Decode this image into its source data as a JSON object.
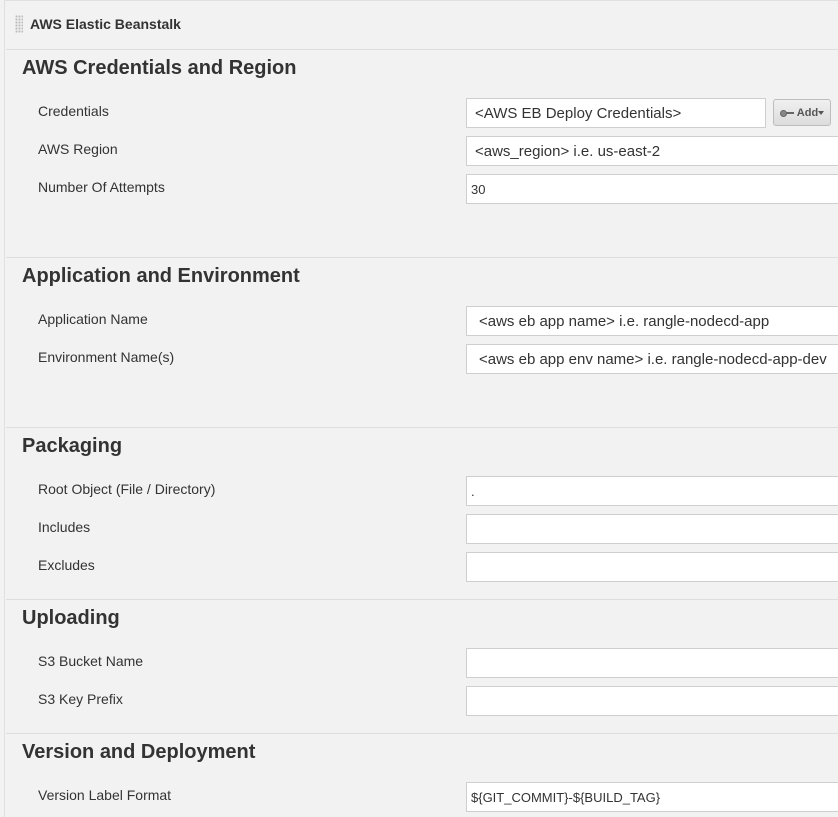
{
  "panel": {
    "title": "AWS Elastic Beanstalk"
  },
  "sections": {
    "credentials": {
      "title": "AWS Credentials and Region",
      "credentials_label": "Credentials",
      "credentials_value": "<AWS EB Deploy Credentials>",
      "add_button_label": "Add",
      "region_label": "AWS Region",
      "region_value": "<aws_region> i.e. us-east-2",
      "attempts_label": "Number Of Attempts",
      "attempts_value": "30"
    },
    "application": {
      "title": "Application and Environment",
      "app_name_label": "Application Name",
      "app_name_value": "<aws eb app name> i.e. rangle-nodecd-app",
      "env_name_label": "Environment Name(s)",
      "env_name_value": "<aws eb app env name> i.e. rangle-nodecd-app-dev"
    },
    "packaging": {
      "title": "Packaging",
      "root_label": "Root Object (File / Directory)",
      "root_value": ".",
      "includes_label": "Includes",
      "includes_value": "",
      "excludes_label": "Excludes",
      "excludes_value": ""
    },
    "uploading": {
      "title": "Uploading",
      "bucket_label": "S3 Bucket Name",
      "bucket_value": "",
      "prefix_label": "S3 Key Prefix",
      "prefix_value": ""
    },
    "version": {
      "title": "Version and Deployment",
      "label_format_label": "Version Label Format",
      "label_format_value": "${GIT_COMMIT}-${BUILD_TAG}"
    }
  },
  "icons": {
    "drag": "drag-handle-icon",
    "key": "key-icon",
    "dropdown": "chevron-down-icon"
  }
}
